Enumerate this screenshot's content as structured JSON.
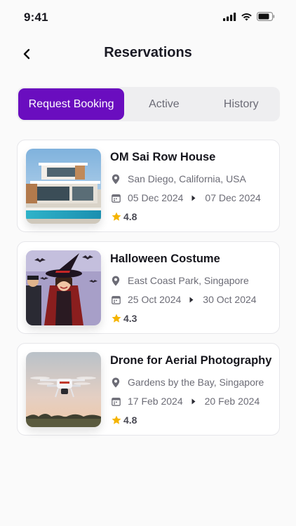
{
  "status_bar": {
    "time": "9:41"
  },
  "header": {
    "title": "Reservations"
  },
  "tabs": [
    {
      "label": "Request Booking",
      "active": true
    },
    {
      "label": "Active",
      "active": false
    },
    {
      "label": "History",
      "active": false
    }
  ],
  "colors": {
    "accent": "#6a0dbf",
    "star": "#f5b400"
  },
  "reservations": [
    {
      "title": "OM Sai Row House",
      "location": "San Diego, California, USA",
      "start_date": "05 Dec 2024",
      "end_date": "07 Dec 2024",
      "rating": "4.8"
    },
    {
      "title": "Halloween Costume",
      "location": "East Coast Park, Singapore",
      "start_date": "25 Oct 2024",
      "end_date": "30 Oct 2024",
      "rating": "4.3"
    },
    {
      "title": "Drone for Aerial Photography",
      "location": "Gardens by the Bay, Singapore",
      "start_date": "17 Feb 2024",
      "end_date": "20 Feb 2024",
      "rating": "4.8"
    }
  ]
}
